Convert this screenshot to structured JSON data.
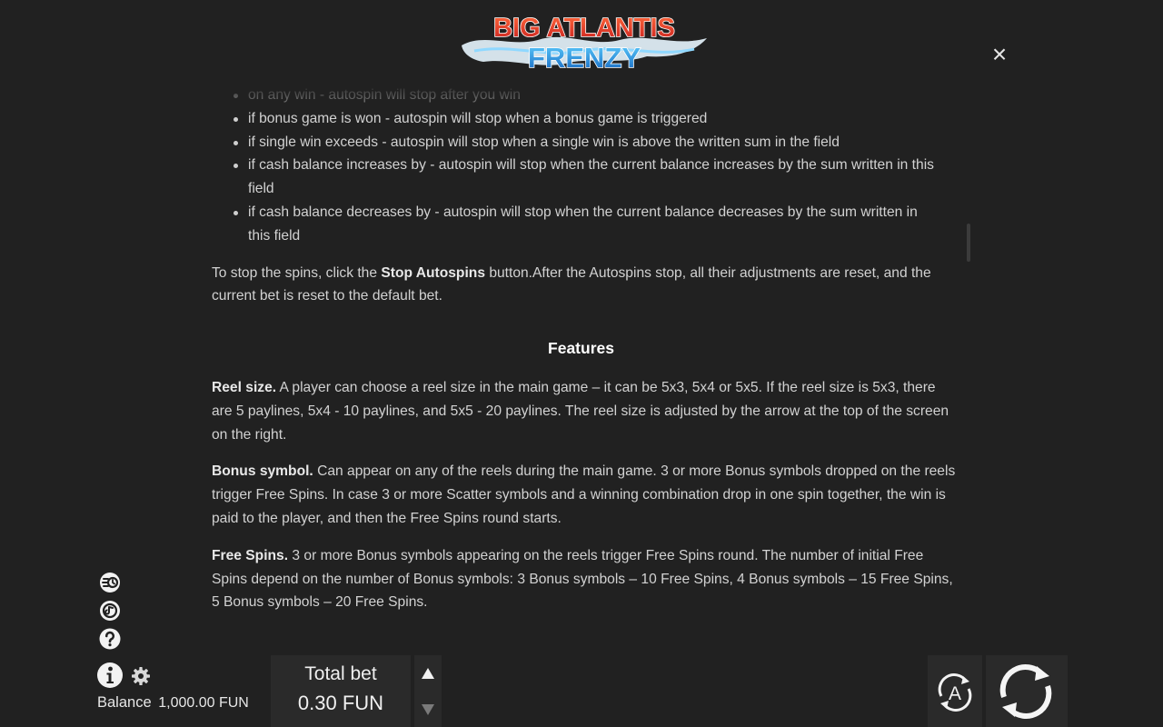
{
  "header": {
    "logo_line1": "BIG ATLANTIS",
    "logo_line2": "FRENZY",
    "close_label": "×"
  },
  "autospin_options": [
    "on any win - autospin will stop after you win",
    "if bonus game is won - autospin will stop when a bonus game is triggered",
    "if single win exceeds - autospin will stop when a single win is above the written sum in the field",
    "if cash balance increases by - autospin will stop when the current balance increases by the sum written in this field",
    "if cash balance decreases by - autospin will stop when the current balance decreases by the sum written in this field"
  ],
  "stop_para": {
    "prefix": "To stop the spins, click the ",
    "bold": "Stop Autospins",
    "suffix": " button.After the Autospins stop, all their adjustments are reset, and the current bet is reset to the default bet."
  },
  "features": {
    "heading": "Features",
    "items": [
      {
        "title": "Reel size.",
        "text": " A player can choose a reel size in the main game – it can be 5x3, 5x4 or 5x5. If the reel size is 5x3, there are 5 paylines, 5x4 - 10 paylines, and 5x5 - 20 paylines. The reel size is adjusted by the arrow at the top of the screen on the right."
      },
      {
        "title": "Bonus symbol.",
        "text": " Can appear on any of the reels during the main game. 3 or more Bonus symbols dropped on the reels trigger Free Spins. In case 3 or more Scatter symbols and a winning combination drop in one spin together, the win is paid to the player, and then the Free Spins round starts."
      },
      {
        "title": "Free Spins.",
        "text": " 3 or more Bonus symbols appearing on the reels trigger Free Spins round. The number of initial Free Spins depend on the number of Bonus symbols: 3 Bonus symbols – 10 Free Spins, 4 Bonus symbols – 15 Free Spins, 5 Bonus symbols – 20 Free Spins."
      }
    ]
  },
  "footer": {
    "balance_label": "Balance",
    "balance_value": "1,000.00 FUN",
    "total_bet_label": "Total bet",
    "total_bet_value": "0.30 FUN",
    "auto_label": "A"
  },
  "colors": {
    "background": "#212121",
    "text": "#d2d2d2",
    "heading": "#ffffff",
    "logo_red": "#e23a2c",
    "logo_blue": "#1e88d6"
  }
}
